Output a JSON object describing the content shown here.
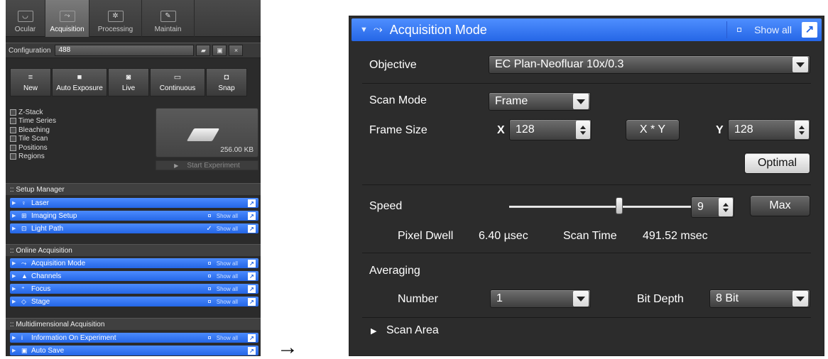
{
  "left": {
    "tabs": [
      {
        "label": "Ocular",
        "icon": "ocular-icon",
        "glyph": "◡"
      },
      {
        "label": "Acquisition",
        "icon": "acquisition-icon",
        "glyph": "⤳"
      },
      {
        "label": "Processing",
        "icon": "processing-icon",
        "glyph": "✲"
      },
      {
        "label": "Maintain",
        "icon": "maintain-icon",
        "glyph": "✎"
      }
    ],
    "configuration": {
      "label": "Configuration",
      "value": "488"
    },
    "toolbar": [
      {
        "label": "New",
        "icon": "new-icon",
        "glyph": "≡"
      },
      {
        "label": "Auto Exposure",
        "icon": "auto-exposure-icon",
        "glyph": "■"
      },
      {
        "label": "Live",
        "icon": "live-icon",
        "glyph": "◙"
      },
      {
        "label": "Continuous",
        "icon": "continuous-icon",
        "glyph": "▭"
      },
      {
        "label": "Snap",
        "icon": "snap-icon",
        "glyph": "◘"
      }
    ],
    "checks": [
      "Z-Stack",
      "Time Series",
      "Bleaching",
      "Tile Scan",
      "Positions",
      "Regions"
    ],
    "preview_size": "256.00 KB",
    "start_experiment": "Start Experiment",
    "setup_manager": {
      "title": ":: Setup Manager",
      "items": [
        {
          "label": "Laser",
          "icon": "laser-icon",
          "glyph": "♀",
          "show_all": "",
          "checked": false
        },
        {
          "label": "Imaging Setup",
          "icon": "imaging-setup-icon",
          "glyph": "⊞",
          "show_all": "Show all",
          "checked": false
        },
        {
          "label": "Light Path",
          "icon": "light-path-icon",
          "glyph": "⊡",
          "show_all": "Show all",
          "checked": true
        }
      ]
    },
    "online_acquisition": {
      "title": ":: Online Acquisition",
      "items": [
        {
          "label": "Acquisition Mode",
          "icon": "acquisition-mode-icon",
          "glyph": "⤳",
          "show_all": "Show all",
          "checked": false
        },
        {
          "label": "Channels",
          "icon": "channels-icon",
          "glyph": "▲",
          "show_all": "Show all",
          "checked": false
        },
        {
          "label": "Focus",
          "icon": "focus-icon",
          "glyph": "⁺",
          "show_all": "Show all",
          "checked": false
        },
        {
          "label": "Stage",
          "icon": "stage-icon",
          "glyph": "◇",
          "show_all": "Show all",
          "checked": false
        }
      ]
    },
    "multidimensional": {
      "title": ":: Multidimensional Acquisition",
      "items": [
        {
          "label": "Information On Experiment",
          "icon": "information-icon",
          "glyph": "i",
          "show_all": "Show all",
          "checked": false
        },
        {
          "label": "Auto Save",
          "icon": "auto-save-icon",
          "glyph": "▣",
          "show_all": "",
          "checked": false
        }
      ]
    }
  },
  "right": {
    "header": {
      "title": "Acquisition Mode",
      "show_all": "Show all"
    },
    "objective": {
      "label": "Objective",
      "value": "EC Plan-Neofluar 10x/0.3"
    },
    "scan_mode": {
      "label": "Scan Mode",
      "value": "Frame"
    },
    "frame_size": {
      "label": "Frame Size",
      "x_label": "X",
      "x_value": "128",
      "swap_label": "X * Y",
      "y_label": "Y",
      "y_value": "128"
    },
    "optimal_label": "Optimal",
    "speed": {
      "label": "Speed",
      "value": "9",
      "max_label": "Max",
      "slider_fraction": 0.6
    },
    "pixel_dwell": {
      "label": "Pixel Dwell",
      "value": "6.40 µsec"
    },
    "scan_time": {
      "label": "Scan Time",
      "value": "491.52 msec"
    },
    "averaging": {
      "label": "Averaging",
      "number_label": "Number",
      "number_value": "1",
      "bit_depth_label": "Bit Depth",
      "bit_depth_value": "8 Bit"
    },
    "scan_area_label": "Scan Area"
  },
  "arrow": "→"
}
